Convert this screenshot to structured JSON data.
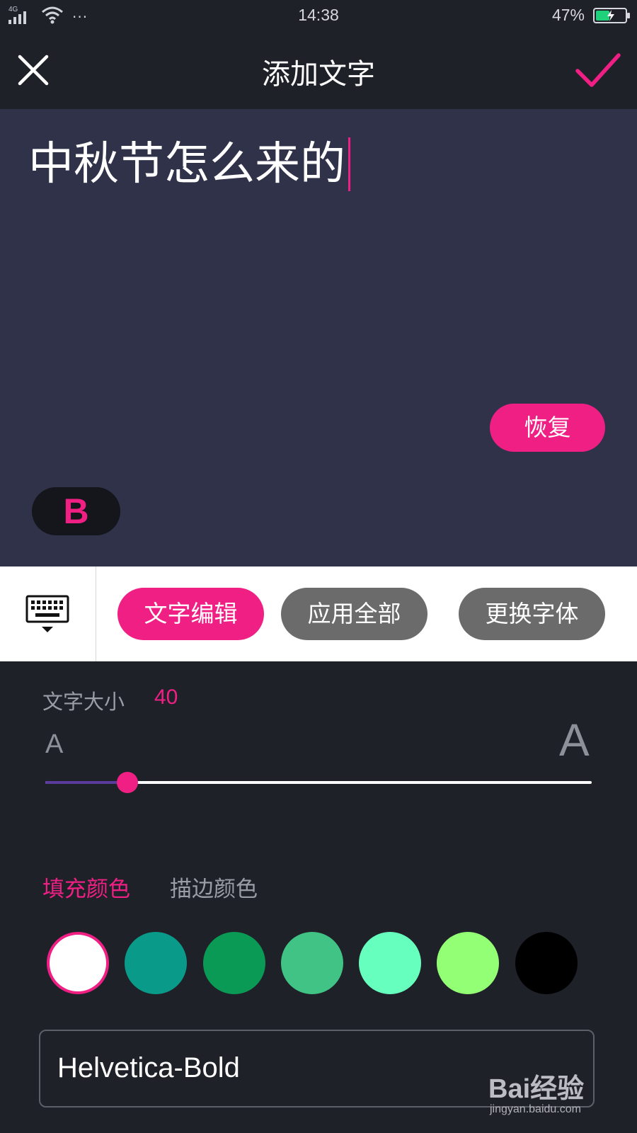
{
  "status_bar": {
    "network": "4G",
    "time": "14:38",
    "battery_percent": "47%",
    "battery_level": 0.47,
    "more_indicator": "···"
  },
  "header": {
    "title": "添加文字",
    "close_icon": "close-icon",
    "confirm_icon": "check-icon"
  },
  "editor": {
    "text": "中秋节怎么来的",
    "restore_label": "恢复",
    "bold_label": "B"
  },
  "toolbar": {
    "keyboard_icon": "keyboard-hide-icon",
    "tabs": [
      {
        "label": "文字编辑",
        "active": true
      },
      {
        "label": "应用全部",
        "active": false
      },
      {
        "label": "更换字体",
        "active": false
      }
    ]
  },
  "size": {
    "label": "文字大小",
    "value": "40",
    "small_a": "A",
    "large_a": "A",
    "slider_fraction": 0.15
  },
  "color_tabs": {
    "fill_label": "填充颜色",
    "stroke_label": "描边颜色",
    "active": "fill"
  },
  "swatches": [
    {
      "color": "#ffffff",
      "selected": true
    },
    {
      "color": "#0a9a8a",
      "selected": false
    },
    {
      "color": "#0a9a55",
      "selected": false
    },
    {
      "color": "#40c385",
      "selected": false
    },
    {
      "color": "#66ffbe",
      "selected": false
    },
    {
      "color": "#93ff74",
      "selected": false
    },
    {
      "color": "#000000",
      "selected": false
    }
  ],
  "font": {
    "name": "Helvetica-Bold"
  },
  "watermark": {
    "logo": "Bai经验",
    "url": "jingyan.baidu.com"
  },
  "colors": {
    "accent": "#ef1f84",
    "header_bg": "#1f2129",
    "editor_bg": "#30324a",
    "pill_inactive": "#6b6b6b"
  }
}
